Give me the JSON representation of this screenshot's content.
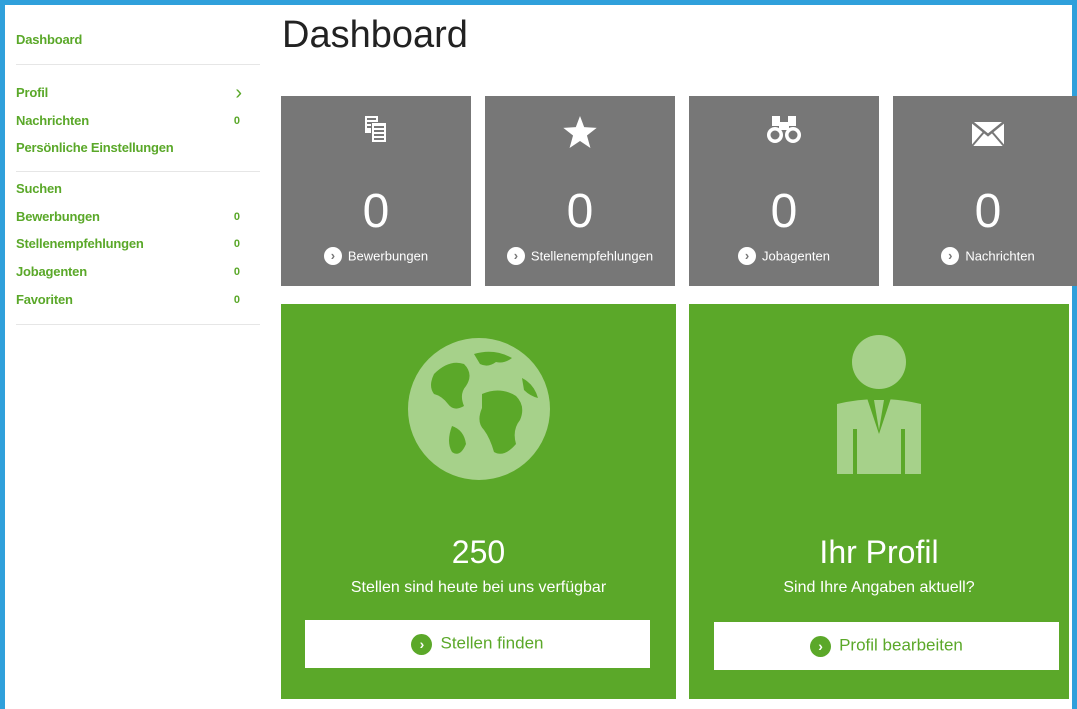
{
  "sidebar": {
    "dashboard": "Dashboard",
    "profil": "Profil",
    "nachrichten": "Nachrichten",
    "nachrichten_count": "0",
    "einstellungen": "Persönliche Einstellungen",
    "suchen": "Suchen",
    "bewerbungen": "Bewerbungen",
    "bewerbungen_count": "0",
    "stellenempfehlungen": "Stellenempfehlungen",
    "stellenempfehlungen_count": "0",
    "jobagenten": "Jobagenten",
    "jobagenten_count": "0",
    "favoriten": "Favoriten",
    "favoriten_count": "0",
    "chevron": "›"
  },
  "main": {
    "title": "Dashboard",
    "tiles": [
      {
        "icon": "documents-icon",
        "count": "0",
        "label": "Bewerbungen"
      },
      {
        "icon": "star-icon",
        "count": "0",
        "label": "Stellenempfehlungen"
      },
      {
        "icon": "binoculars-icon",
        "count": "0",
        "label": "Jobagenten"
      },
      {
        "icon": "envelope-icon",
        "count": "0",
        "label": "Nachrichten"
      }
    ],
    "jobs_card": {
      "icon": "globe-icon",
      "number": "250",
      "subtitle": "Stellen sind heute bei uns verfügbar",
      "button": "Stellen finden"
    },
    "profile_card": {
      "icon": "person-icon",
      "title": "Ihr Profil",
      "subtitle": "Sind Ihre Angaben aktuell?",
      "button": "Profil bearbeiten"
    }
  },
  "colors": {
    "accent_green": "#5ba829",
    "tile_gray": "#777777",
    "frame_blue": "#2fa0db"
  }
}
